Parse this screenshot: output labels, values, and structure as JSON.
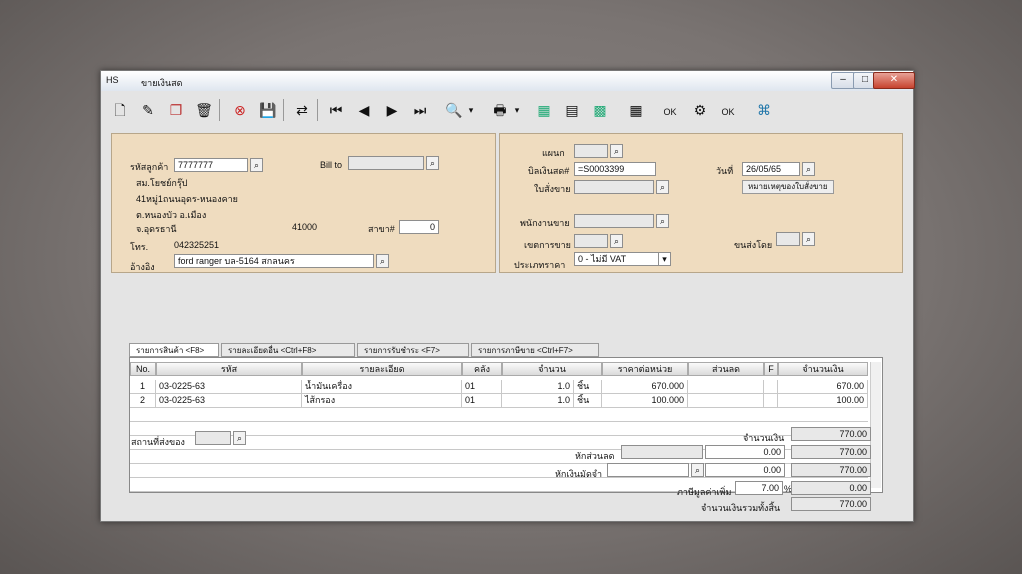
{
  "window": {
    "app_icon": "HS",
    "title": "ขายเงินสด"
  },
  "toolbar": {
    "icons": [
      "new-icon",
      "edit-icon",
      "copy-icon",
      "delete-icon",
      "cancel-icon",
      "save-icon",
      "transfer-icon",
      "first-icon",
      "prev-icon",
      "next-icon",
      "last-icon",
      "preview-icon",
      "print-icon",
      "calc-icon",
      "report-icon",
      "grid-icon",
      "table-icon",
      "ok-icon",
      "tools-icon",
      "ok-icon",
      "network-icon"
    ]
  },
  "customer": {
    "code_label": "รหัสลูกค้า",
    "code": "7777777",
    "bill_to_label": "Bill to",
    "bill_to": "",
    "name": "สม.โยชย์กรุ๊ป",
    "addr1": "41หมู่1ถนนอุดร-หนองคาย",
    "addr2": "ต.หนองบัว อ.เมือง",
    "addr3": "จ.อุดรธานี",
    "postcode": "41000",
    "branch_label": "สาขา#",
    "branch": "0",
    "phone_label": "โทร.",
    "phone": "042325251",
    "reference_label": "อ้างอิง",
    "reference": "ford ranger บล-5164 สกลนคร"
  },
  "document": {
    "dept_label": "แผนก",
    "dept": "",
    "doc_no_label": "บิลเงินสด#",
    "doc_no": "=S0003399",
    "date_label": "วันที่",
    "date": "26/05/65",
    "order_label": "ใบสั่งขาย",
    "order": "",
    "note_button": "หมายเหตุของใบสั่งขาย",
    "salesman_label": "พนักงานขาย",
    "salesman": "",
    "area_label": "เขตการขาย",
    "area": "",
    "delivery_label": "ขนส่งโดย",
    "delivery": "",
    "price_type_label": "ประเภทราคา",
    "price_type": "0 - ไม่มี VAT"
  },
  "tabs": [
    "รายการสินค้า <F8>",
    "รายละเอียดอื่น <Ctrl+F8>",
    "รายการรับชำระ <F7>",
    "รายการภาษีขาย <Ctrl+F7>"
  ],
  "grid": {
    "headers": [
      "No.",
      "รหัส",
      "รายละเอียด",
      "คลัง",
      "จำนวน",
      "ราคาต่อหน่วย",
      "ส่วนลด",
      "F",
      "จำนวนเงิน"
    ],
    "rows": [
      [
        "1",
        "03-0225-63",
        "น้ำมันเครื่อง",
        "01",
        "1.0",
        "ชิ้น",
        "670.000",
        "",
        "",
        "670.00"
      ],
      [
        "2",
        "03-0225-63",
        "ไส้กรอง",
        "01",
        "1.0",
        "ชิ้น",
        "100.000",
        "",
        "",
        "100.00"
      ]
    ]
  },
  "footer": {
    "ship_place_label": "สถานที่ส่งของ",
    "ship_place": "",
    "amount_label": "จำนวนเงิน",
    "amount": "770.00",
    "discount_label": "หักส่วนลด",
    "discount_text": "",
    "discount_value": "0.00",
    "after_discount": "770.00",
    "deposit_label": "หักเงินมัดจำ",
    "deposit_ref": "",
    "deposit_value": "0.00",
    "after_deposit": "770.00",
    "vat_label": "ภาษีมูลค่าเพิ่ม",
    "vat_rate": "7.00",
    "vat_unit": "%",
    "vat_value": "0.00",
    "net_label": "จำนวนเงินรวมทั้งสิ้น",
    "net_total": "770.00"
  }
}
